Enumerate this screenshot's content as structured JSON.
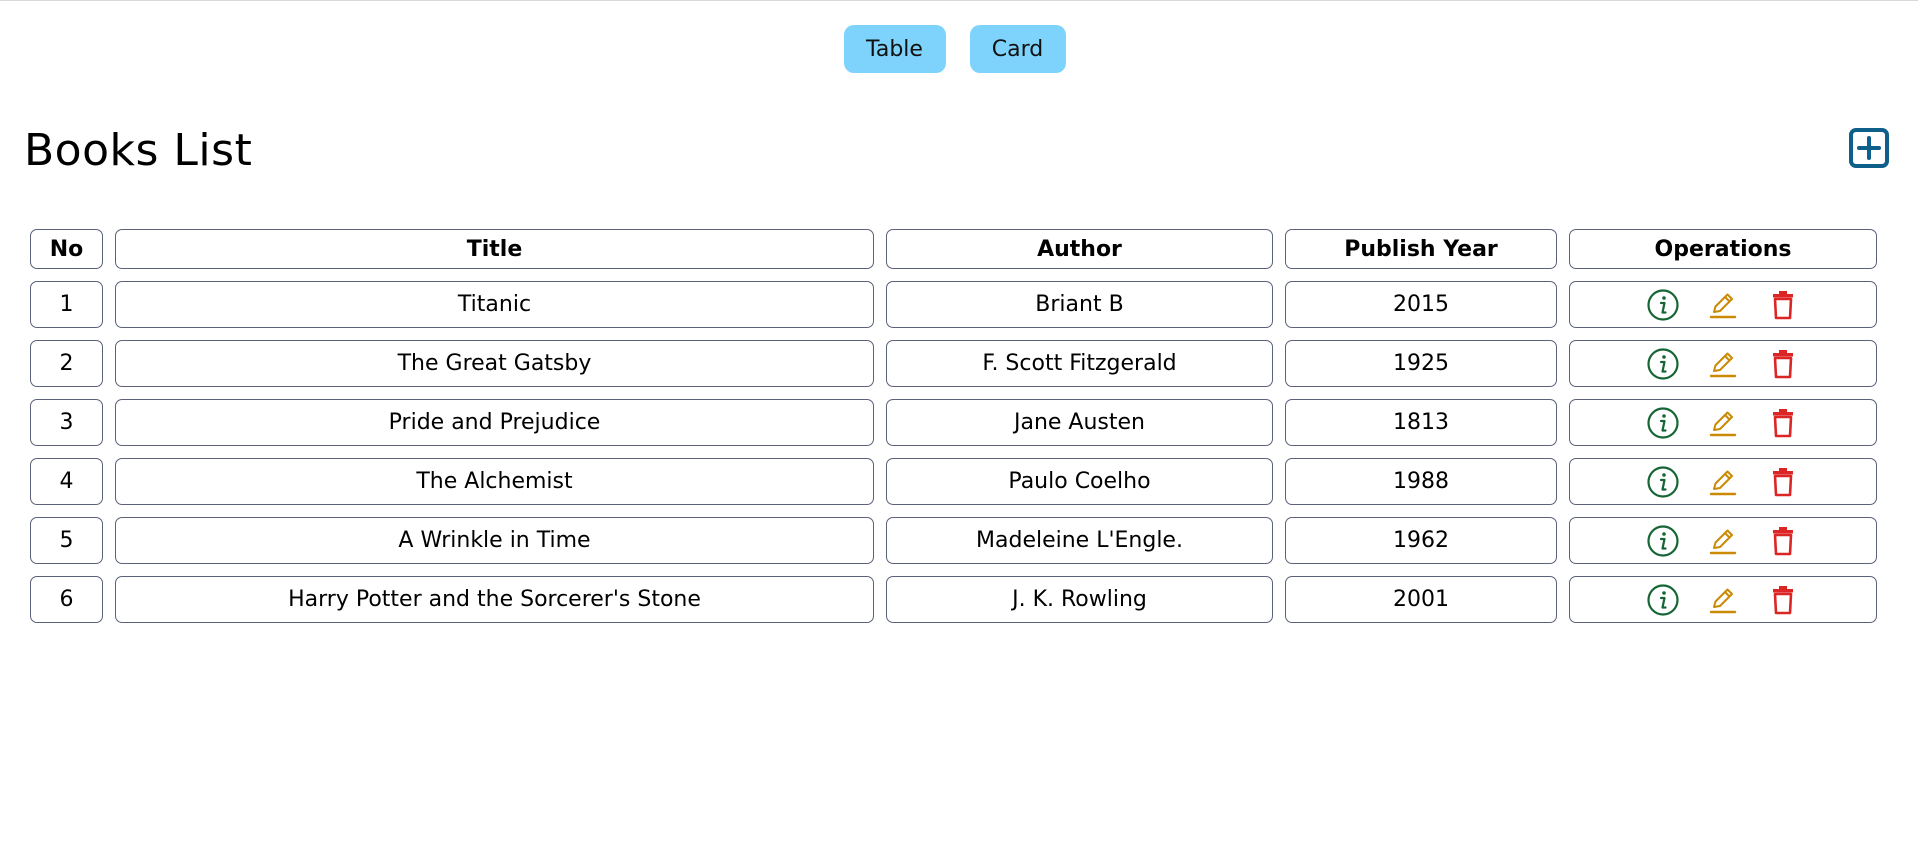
{
  "view_toggle": {
    "table_label": "Table",
    "card_label": "Card",
    "color": "#7dd3fc"
  },
  "page_title": "Books List",
  "add_button": {
    "icon": "plus-square-icon",
    "color": "#0e5f8a"
  },
  "table": {
    "headers": {
      "no": "No",
      "title": "Title",
      "author": "Author",
      "publish_year": "Publish Year",
      "operations": "Operations"
    },
    "rows": [
      {
        "no": "1",
        "title": "Titanic",
        "author": "Briant B",
        "publish_year": "2015"
      },
      {
        "no": "2",
        "title": "The Great Gatsby",
        "author": "F. Scott Fitzgerald",
        "publish_year": "1925"
      },
      {
        "no": "3",
        "title": "Pride and Prejudice",
        "author": "Jane Austen",
        "publish_year": "1813"
      },
      {
        "no": "4",
        "title": "The Alchemist",
        "author": "Paulo Coelho",
        "publish_year": "1988"
      },
      {
        "no": "5",
        "title": "A Wrinkle in Time",
        "author": "Madeleine L'Engle.",
        "publish_year": "1962"
      },
      {
        "no": "6",
        "title": "Harry Potter and the Sorcerer's Stone",
        "author": "J. K. Rowling",
        "publish_year": "2001"
      }
    ],
    "operation_icons": {
      "info": {
        "icon": "info-circle-icon",
        "color": "#166534"
      },
      "edit": {
        "icon": "pencil-icon",
        "color": "#ca8a04"
      },
      "delete": {
        "icon": "trash-icon",
        "color": "#dc2626"
      }
    }
  }
}
